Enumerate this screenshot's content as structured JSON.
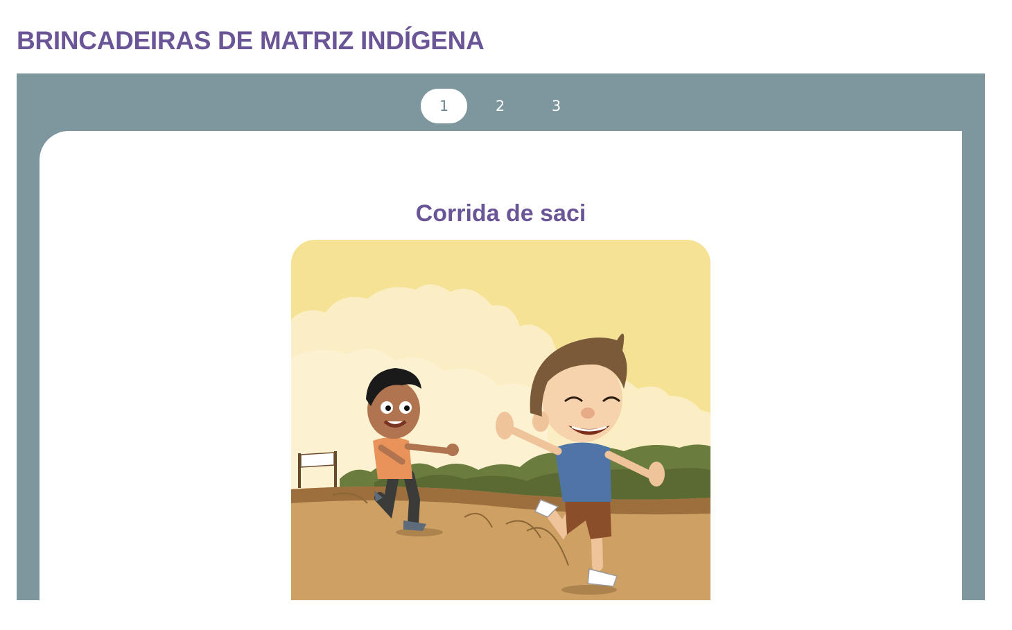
{
  "page": {
    "title": "BRINCADEIRAS DE MATRIZ INDÍGENA"
  },
  "tabs": [
    {
      "label": "1",
      "active": true
    },
    {
      "label": "2",
      "active": false
    },
    {
      "label": "3",
      "active": false
    }
  ],
  "slide": {
    "title": "Corrida de saci",
    "image_description": "two-boys-hopping-race-illustration"
  },
  "colors": {
    "title_purple": "#6a5597",
    "panel_slate": "#7e979e",
    "sky_yellow": "#f5e294",
    "ground_tan": "#cfa064"
  }
}
